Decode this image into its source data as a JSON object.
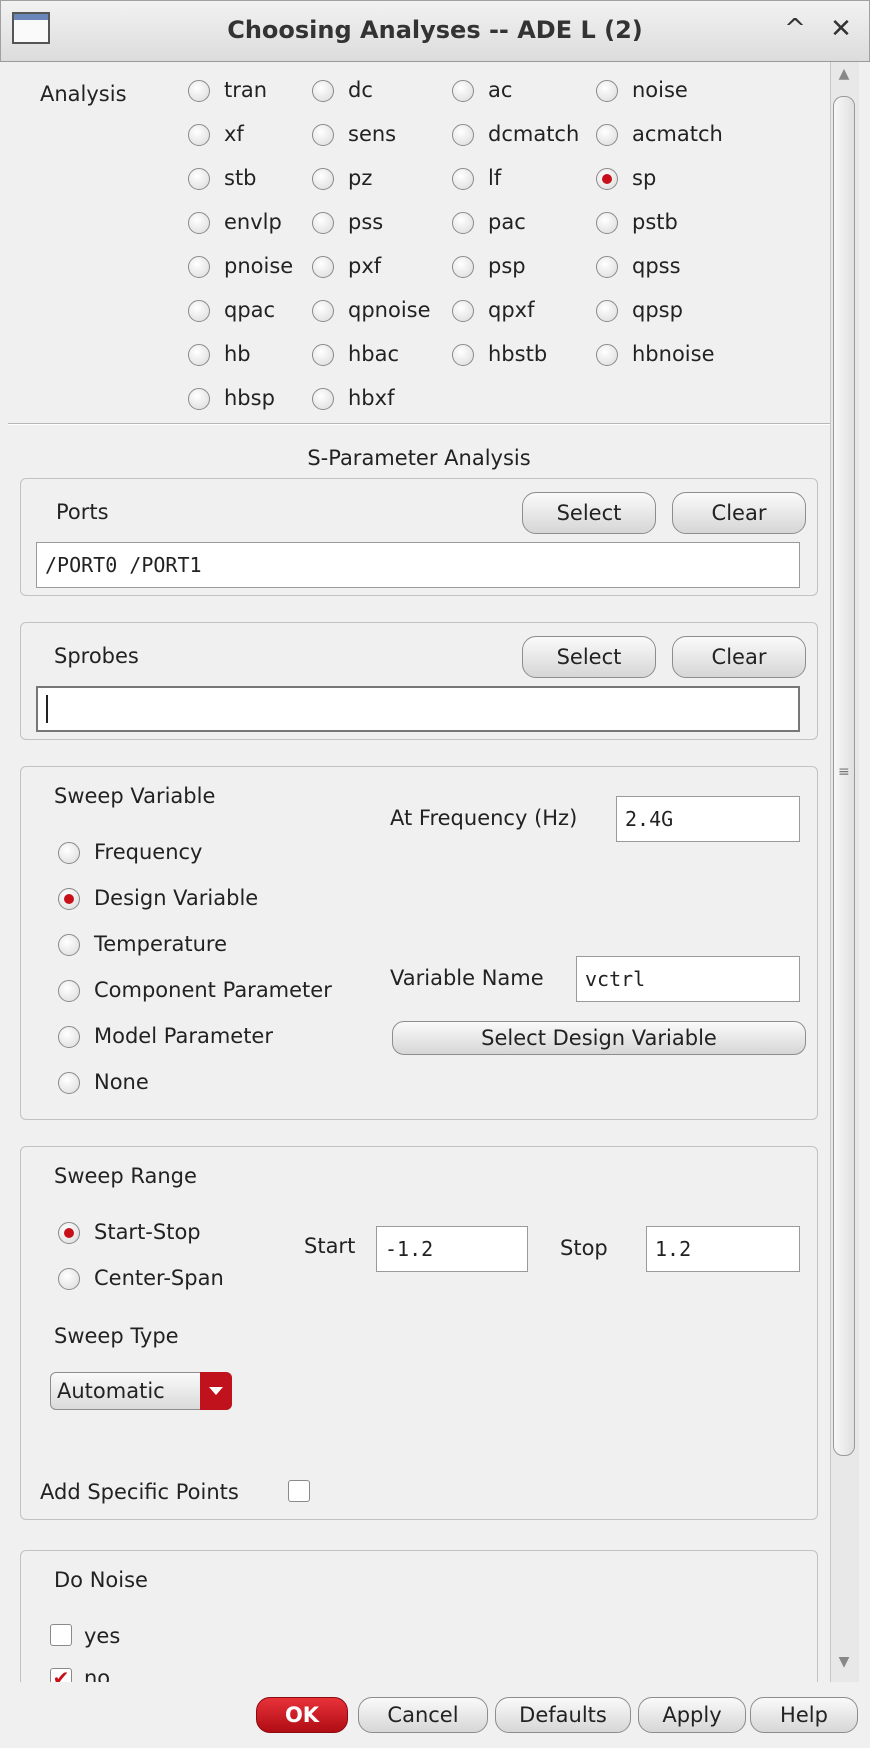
{
  "window": {
    "title": "Choosing Analyses -- ADE L (2)",
    "minimize_glyph": "^",
    "close_glyph": "✕"
  },
  "analysis": {
    "label": "Analysis",
    "options": [
      {
        "label": "tran",
        "selected": false
      },
      {
        "label": "dc",
        "selected": false
      },
      {
        "label": "ac",
        "selected": false
      },
      {
        "label": "noise",
        "selected": false
      },
      {
        "label": "xf",
        "selected": false
      },
      {
        "label": "sens",
        "selected": false
      },
      {
        "label": "dcmatch",
        "selected": false
      },
      {
        "label": "acmatch",
        "selected": false
      },
      {
        "label": "stb",
        "selected": false
      },
      {
        "label": "pz",
        "selected": false
      },
      {
        "label": "lf",
        "selected": false
      },
      {
        "label": "sp",
        "selected": true
      },
      {
        "label": "envlp",
        "selected": false
      },
      {
        "label": "pss",
        "selected": false
      },
      {
        "label": "pac",
        "selected": false
      },
      {
        "label": "pstb",
        "selected": false
      },
      {
        "label": "pnoise",
        "selected": false
      },
      {
        "label": "pxf",
        "selected": false
      },
      {
        "label": "psp",
        "selected": false
      },
      {
        "label": "qpss",
        "selected": false
      },
      {
        "label": "qpac",
        "selected": false
      },
      {
        "label": "qpnoise",
        "selected": false
      },
      {
        "label": "qpxf",
        "selected": false
      },
      {
        "label": "qpsp",
        "selected": false
      },
      {
        "label": "hb",
        "selected": false
      },
      {
        "label": "hbac",
        "selected": false
      },
      {
        "label": "hbstb",
        "selected": false
      },
      {
        "label": "hbnoise",
        "selected": false
      },
      {
        "label": "hbsp",
        "selected": false
      },
      {
        "label": "hbxf",
        "selected": false
      }
    ]
  },
  "sp_title": "S-Parameter Analysis",
  "ports": {
    "label": "Ports",
    "select": "Select",
    "clear": "Clear",
    "value": "/PORT0 /PORT1"
  },
  "sprobes": {
    "label": "Sprobes",
    "select": "Select",
    "clear": "Clear",
    "value": ""
  },
  "sweep_variable": {
    "label": "Sweep Variable",
    "options": [
      {
        "label": "Frequency",
        "selected": false
      },
      {
        "label": "Design Variable",
        "selected": true
      },
      {
        "label": "Temperature",
        "selected": false
      },
      {
        "label": "Component Parameter",
        "selected": false
      },
      {
        "label": "Model Parameter",
        "selected": false
      },
      {
        "label": "None",
        "selected": false
      }
    ],
    "at_frequency_label": "At Frequency (Hz)",
    "at_frequency_value": "2.4G",
    "variable_name_label": "Variable Name",
    "variable_name_value": "vctrl",
    "select_design_variable": "Select Design Variable"
  },
  "sweep_range": {
    "label": "Sweep Range",
    "options": [
      {
        "label": "Start-Stop",
        "selected": true
      },
      {
        "label": "Center-Span",
        "selected": false
      }
    ],
    "start_label": "Start",
    "start_value": "-1.2",
    "stop_label": "Stop",
    "stop_value": "1.2",
    "sweep_type_label": "Sweep Type",
    "sweep_type_value": "Automatic",
    "add_points_label": "Add Specific Points",
    "add_points_checked": false
  },
  "do_noise": {
    "label": "Do Noise",
    "yes_label": "yes",
    "yes_checked": false,
    "no_label": "no",
    "no_checked": true
  },
  "buttons": {
    "ok": "OK",
    "cancel": "Cancel",
    "defaults": "Defaults",
    "apply": "Apply",
    "help": "Help"
  }
}
